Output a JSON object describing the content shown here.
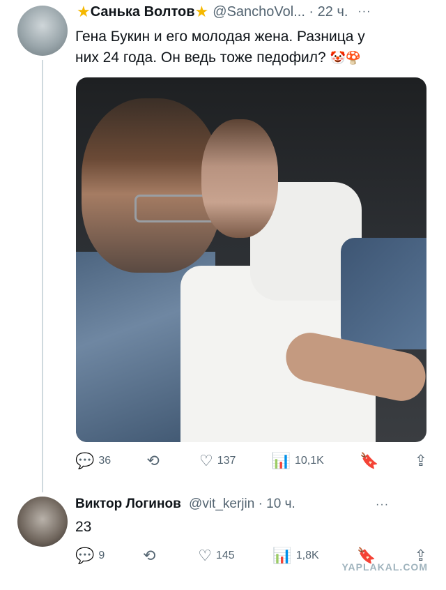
{
  "tweet": {
    "display_name": "Санька Волтов",
    "handle_time": "@SanchoVol... · 22 ч.",
    "more": "···",
    "text_line1": "Гена Букин и его молодая жена. Разница у",
    "text_line2": "них 24 года. Он ведь тоже педофил?",
    "emoji": "🤡🍄",
    "stats": {
      "replies": "36",
      "retweets": "",
      "likes": "137",
      "views": "10,1K"
    }
  },
  "reply": {
    "display_name": "Виктор Логинов",
    "handle_time": "@vit_kerjin · 10 ч.",
    "more": "···",
    "text": "23",
    "stats": {
      "replies": "9",
      "retweets": "",
      "likes": "145",
      "views": "1,8K"
    }
  },
  "watermark": "YAPLAKAL.COM",
  "colors": {
    "meta": "#536471",
    "thread_line": "#cfd9de",
    "star": "#f5b800"
  }
}
